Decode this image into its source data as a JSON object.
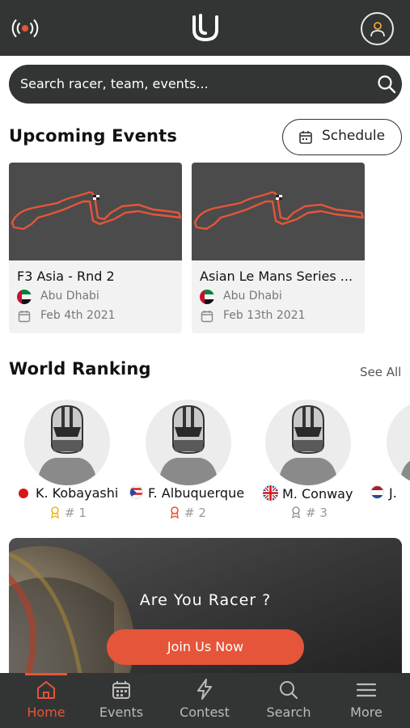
{
  "header": {
    "live_icon": "broadcast-icon",
    "logo_icon": "u-logo-icon",
    "profile_icon": "user-icon"
  },
  "search": {
    "placeholder": "Search racer, team, events...",
    "icon": "search-icon"
  },
  "upcoming": {
    "title": "Upcoming Events",
    "schedule_label": "Schedule",
    "events": [
      {
        "name": "F3 Asia - Rnd 2",
        "location": "Abu Dhabi",
        "date": "Feb 4th 2021"
      },
      {
        "name": "Asian Le Mans Series ...",
        "location": "Abu Dhabi",
        "date": "Feb 13th 2021"
      }
    ]
  },
  "ranking": {
    "title": "World Ranking",
    "see_all": "See All",
    "racers": [
      {
        "name": "K. Kobayashi",
        "rank": "# 1"
      },
      {
        "name": "F. Albuquerque",
        "rank": "# 2"
      },
      {
        "name": "M. Conway",
        "rank": "# 3"
      },
      {
        "name": "J.",
        "rank": ""
      }
    ]
  },
  "banner": {
    "title": "Are You Racer ?",
    "cta": "Join Us Now"
  },
  "nav": [
    {
      "label": "Home",
      "icon": "home-icon"
    },
    {
      "label": "Events",
      "icon": "calendar-icon"
    },
    {
      "label": "Contest",
      "icon": "lightning-icon"
    },
    {
      "label": "Search",
      "icon": "search-icon"
    },
    {
      "label": "More",
      "icon": "menu-icon"
    }
  ],
  "colors": {
    "accent": "#e5553a",
    "dark": "#333534"
  }
}
